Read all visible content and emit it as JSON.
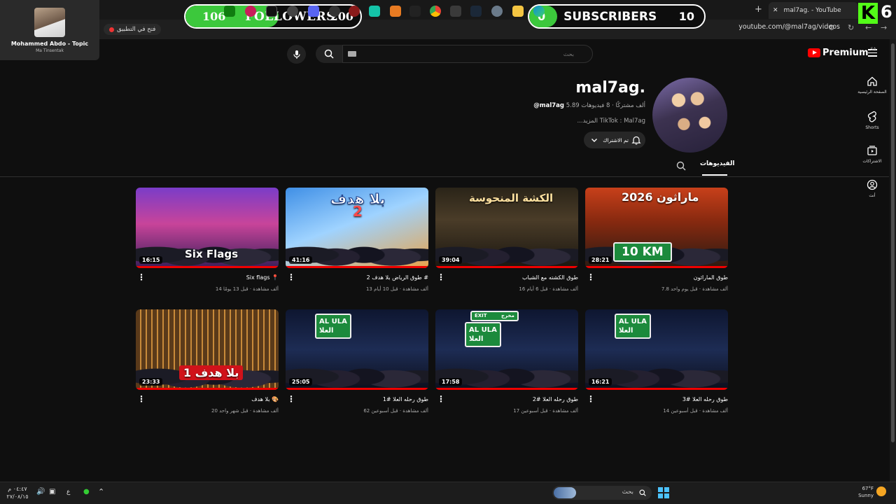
{
  "browser": {
    "tab_title": "mal7ag. - YouTube",
    "url": "youtube.com/@mal7ag/videos",
    "new_tab_symbol": "+",
    "tab_close_symbol": "✕",
    "open_app_label": "فتح في التطبيق"
  },
  "overlays": {
    "followers": {
      "current": "106",
      "label": "FOLLOWERS",
      "goal": "200",
      "progress_percent": 53
    },
    "subscribers": {
      "current": "0",
      "label": "SUBSCRIBERS",
      "goal": "10",
      "progress_percent": 0
    },
    "kick_badge": "K",
    "kick_count": "6",
    "now_playing": {
      "title": "Mohammed Abdo - Topic",
      "subtitle": "Ma Tinsentak"
    }
  },
  "header": {
    "logo_text": "Premium",
    "logo_region": "SA",
    "search_placeholder": "بحث"
  },
  "sidebar": {
    "items": [
      {
        "label": "الصفحة الرئيسية",
        "icon": "home-icon"
      },
      {
        "label": "Shorts",
        "icon": "shorts-icon"
      },
      {
        "label": "الاشتراكات",
        "icon": "subscriptions-icon"
      },
      {
        "label": "أنت",
        "icon": "you-icon"
      }
    ]
  },
  "channel": {
    "name": "mal7ag.",
    "handle": "@mal7ag",
    "stats": "5.89 ألف مشتركًا · 8 فيديوهات",
    "description": "TikTok : Mal7ag",
    "more_label": "...المزيد",
    "subscribe_label": "تم الاشتراك",
    "tab_videos": "الفيديوهات"
  },
  "videos": [
    {
      "title": "طوق الماراثون",
      "meta": "7.8 ألف مشاهدة · قبل يوم واحد",
      "duration": "28:21",
      "thumb_text": "ماراثون 2026",
      "thumb_sub": "10 KM"
    },
    {
      "title": "طوق الكشته مع الشباب",
      "meta": "16 ألف مشاهدة · قبل 6 أيام",
      "duration": "39:04",
      "thumb_text": "الكشة المنحوسة"
    },
    {
      "title": "طوق الرياض بلا هدف 2 #",
      "meta": "13 ألف مشاهدة · قبل 10 أيام",
      "duration": "41:16",
      "thumb_text": "بلا هدف",
      "thumb_sub": "2"
    },
    {
      "title": "Six flags 📍",
      "meta": "14 ألف مشاهدة · قبل 13 يومًا",
      "duration": "16:15",
      "thumb_text": "Six Flags"
    },
    {
      "title": "طوق رحله العلا #3",
      "meta": "14 ألف مشاهدة · قبل أسبوعين",
      "duration": "16:21",
      "thumb_text": "AL ULA",
      "thumb_sub": "العلا"
    },
    {
      "title": "طوق رحله العلا #2",
      "meta": "17 ألف مشاهدة · قبل أسبوعين",
      "duration": "17:58",
      "thumb_text": "AL ULA",
      "thumb_sub": "العلا",
      "thumb_extra": "EXIT",
      "thumb_extra2": "مخرج"
    },
    {
      "title": "طوق رحله العلا #1",
      "meta": "62 ألف مشاهدة · قبل أسبوعين",
      "duration": "25:05",
      "thumb_text": "AL ULA",
      "thumb_sub": "العلا"
    },
    {
      "title": "بلا هدف 🎨",
      "meta": "20 ألف مشاهدة · قبل شهر واحد",
      "duration": "23:33",
      "thumb_text": "بلا هدف 1"
    }
  ],
  "taskbar": {
    "search_label": "بحث",
    "weather_temp": "67°F",
    "weather_cond": "Sunny",
    "time": "٠٤:٤٧ م",
    "date": "٢٧/٠٨/١٥",
    "lang": "ع"
  },
  "colors": {
    "accent": "#ff0000",
    "progress_green": "#3cc83c",
    "kick_green": "#53fc18"
  }
}
